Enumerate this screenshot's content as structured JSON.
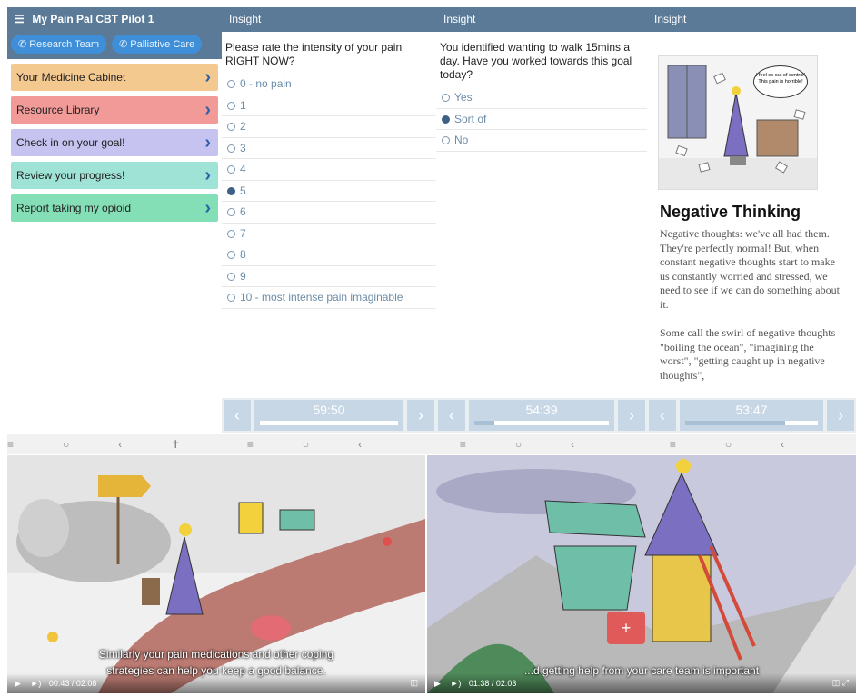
{
  "panel1": {
    "title": "My Pain Pal CBT Pilot 1",
    "pills": [
      "Research Team",
      "Palliative Care"
    ],
    "menu": [
      {
        "label": "Your Medicine Cabinet",
        "color": "#f4c98f"
      },
      {
        "label": "Resource Library",
        "color": "#f29a98"
      },
      {
        "label": "Check in on your goal!",
        "color": "#c7c3f1"
      },
      {
        "label": "Review your progress!",
        "color": "#9fe2d6"
      },
      {
        "label": "Report taking my opioid",
        "color": "#85dfb6"
      }
    ]
  },
  "panel2": {
    "header": "Insight",
    "question": "Please rate the intensity of your pain RIGHT NOW?",
    "options": [
      "0 - no pain",
      "1",
      "2",
      "3",
      "4",
      "5",
      "6",
      "7",
      "8",
      "9",
      "10 - most intense pain imaginable"
    ],
    "selected_index": 5,
    "timer": "59:50",
    "progress": 0.0
  },
  "panel3": {
    "header": "Insight",
    "question": "You identified wanting to walk 15mins a day. Have you worked towards this goal today?",
    "options": [
      "Yes",
      "Sort of",
      "No"
    ],
    "selected_index": 1,
    "timer": "54:39",
    "progress": 0.15
  },
  "panel4": {
    "header": "Insight",
    "bubble": "I feel so out of control! This pain is horrible!",
    "title": "Negative Thinking",
    "paragraphs": [
      "Negative thoughts: we've all had them. They're perfectly normal! But, when constant negative thoughts start to make us constantly worried and stressed, we need to see if we can do something about it.",
      "Some call the swirl of negative thoughts \"boiling the ocean\", \"imagining the worst\", \"getting caught up in negative thoughts\","
    ],
    "timer": "53:47",
    "progress": 0.75
  },
  "video1": {
    "subtitle_lines": [
      "Similarly your pain medications and other coping",
      "strategies can help you keep a good balance."
    ],
    "time": "00:43 / 02:08"
  },
  "video2": {
    "subtitle_lines": [
      "...d getting help from your care team is important"
    ],
    "time": "01:38 / 02:03"
  }
}
